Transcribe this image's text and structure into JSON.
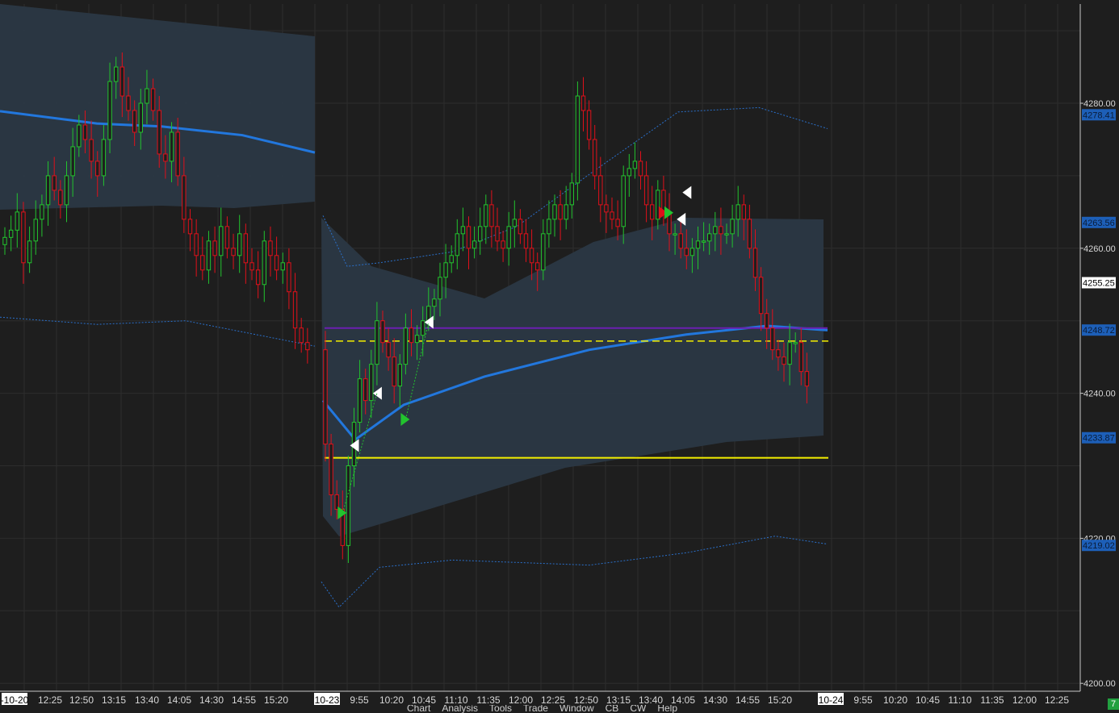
{
  "chart_data": {
    "type": "candlestick",
    "y_axis": {
      "ticks": [
        "4280.00",
        "4260.00",
        "4240.00",
        "4220.00",
        "4200.00"
      ],
      "ylim": [
        4199,
        4292
      ]
    },
    "x_axis": {
      "tick_labels": [
        "-10-20",
        "12:25",
        "12:50",
        "13:15",
        "13:40",
        "14:05",
        "14:30",
        "14:55",
        "15:20",
        "10-23",
        "9:55",
        "10:20",
        "10:45",
        "11:10",
        "11:35",
        "12:00",
        "12:25",
        "12:50",
        "13:15",
        "13:40",
        "14:05",
        "14:30",
        "14:55",
        "15:20",
        "10-24",
        "9:55",
        "10:20",
        "10:45",
        "11:10",
        "11:35",
        "12:00",
        "12:25"
      ],
      "highlighted": [
        "-10-20",
        "10-23",
        "10-24"
      ]
    },
    "price_badges": [
      {
        "label": "4278.41",
        "value": 4278.41,
        "style": "blue"
      },
      {
        "label": "4263.56",
        "value": 4263.56,
        "style": "blue"
      },
      {
        "label": "4255.25",
        "value": 4255.25,
        "style": "current"
      },
      {
        "label": "4248.72",
        "value": 4248.72,
        "style": "blue"
      },
      {
        "label": "4233.87",
        "value": 4233.87,
        "style": "blue"
      },
      {
        "label": "4219.02",
        "value": 4219.02,
        "style": "blue"
      }
    ],
    "price_series": [
      4261.5,
      4262.5,
      4265,
      4258,
      4261,
      4264,
      4266,
      4270,
      4268,
      4266,
      4270,
      4274,
      4277,
      4275,
      4272,
      4270,
      4275,
      4283,
      4285,
      4281,
      4279,
      4276,
      4280,
      4282,
      4279,
      4273,
      4272,
      4276,
      4270,
      4264,
      4262,
      4259,
      4257,
      4261,
      4259,
      4263,
      4260,
      4259,
      4262,
      4258,
      4257,
      4255,
      4261,
      4259,
      4257,
      4258,
      4254,
      4249,
      4247,
      4246,
      4233,
      4226,
      4224,
      4219,
      4230,
      4236,
      4242,
      4239,
      4244,
      4250,
      4247,
      4245,
      4241,
      4244,
      4249,
      4247,
      4248,
      4250,
      4252,
      4253,
      4256,
      4258,
      4259,
      4262,
      4263,
      4260,
      4261,
      4263,
      4266,
      4263,
      4261,
      4260,
      4263,
      4264,
      4262,
      4260,
      4258,
      4257,
      4262,
      4264,
      4266,
      4264,
      4266,
      4269,
      4281,
      4279,
      4275,
      4270,
      4266,
      4265,
      4264,
      4263,
      4270,
      4271,
      4272,
      4270,
      4266,
      4264,
      4268,
      4265,
      4262,
      4262,
      4260,
      4259,
      4260,
      4261,
      4261,
      4262,
      4263,
      4262,
      4262,
      4264,
      4266,
      4264,
      4260,
      4256,
      4251,
      4249,
      4246,
      4245,
      4244,
      4247,
      4247,
      4243,
      4241
    ],
    "series": [
      {
        "name": "",
        "type": "vwap",
        "color": "#2277dd"
      },
      {
        "name": "",
        "type": "band-upper",
        "color": "#2a6fc9"
      },
      {
        "name": "",
        "type": "band-lower",
        "color": "#2a6fc9"
      },
      {
        "name": "",
        "type": "value-area",
        "color": "#2b3846"
      }
    ],
    "reference_lines": [
      {
        "value": 4231.1,
        "color": "#f5f000",
        "style": "solid"
      },
      {
        "value": 4247.2,
        "color": "#f5f000",
        "style": "dashed"
      },
      {
        "value": 4249.0,
        "color": "#6a1fb0",
        "style": "solid"
      }
    ],
    "colors": {
      "up": "#22c32e",
      "down": "#e0101a",
      "background": "#1e1e1e",
      "grid": "#2d2d2d"
    }
  },
  "menu": [
    "Chart",
    "Analysis",
    "Tools",
    "Trade",
    "Window",
    "CB",
    "CW",
    "Help"
  ],
  "status_badge": "7"
}
